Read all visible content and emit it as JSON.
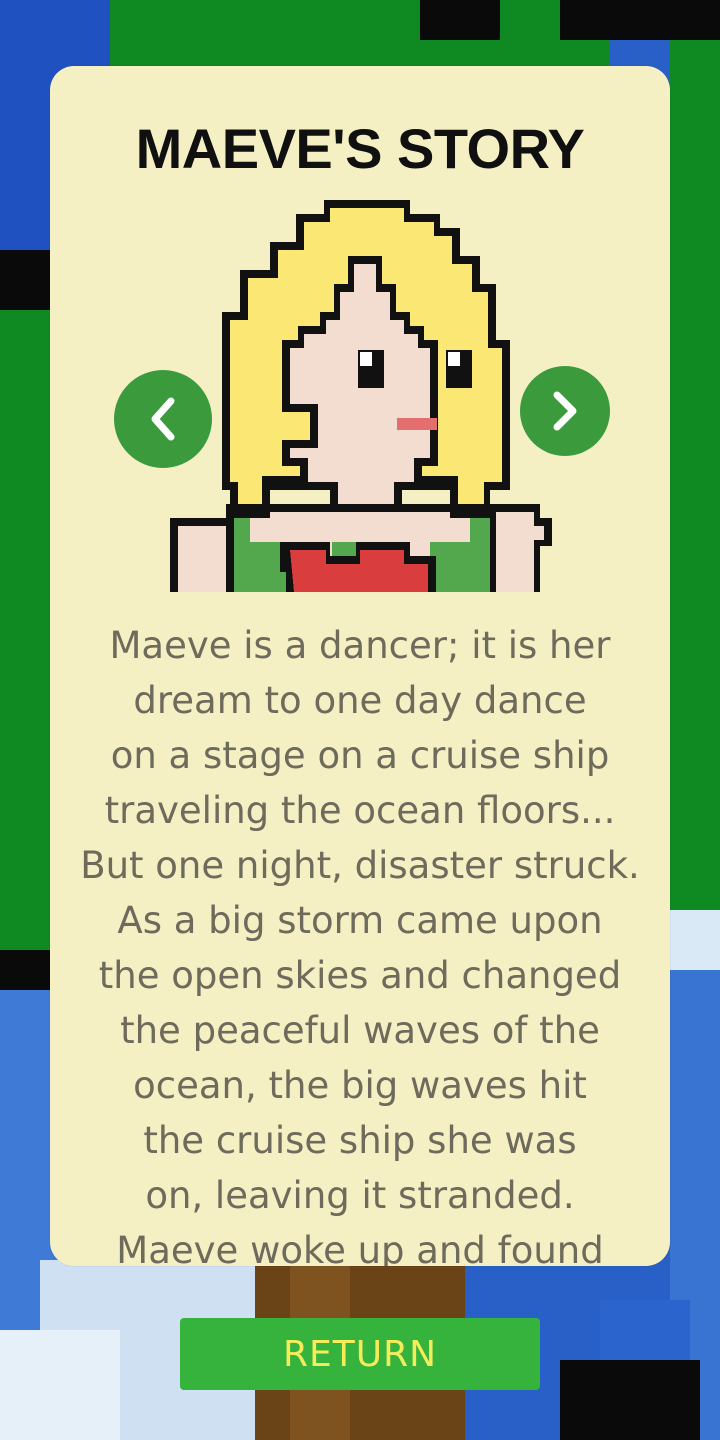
{
  "title": "MAEVE'S STORY",
  "story_lines": [
    "Maeve is a dancer; it is her",
    "dream to one day dance",
    "on a stage on a cruise ship",
    "traveling the ocean floors...",
    "But one night, disaster struck.",
    "As a big storm came upon",
    "the open skies and changed",
    "the peaceful waves of the",
    "ocean, the big waves hit",
    "the cruise ship she was",
    "on, leaving it stranded.",
    "Maeve woke up and found"
  ],
  "return_label": "RETURN",
  "icons": {
    "prev": "chevron-left-icon",
    "next": "chevron-right-icon"
  },
  "colors": {
    "card_bg": "#f5f0c4",
    "nav_button": "#3a9a3c",
    "return_button": "#36b33d",
    "return_text": "#f6ec5a",
    "story_text": "#6e6a5c",
    "sky_blue": "#2b63c9",
    "tree_green": "#0c8a22"
  }
}
